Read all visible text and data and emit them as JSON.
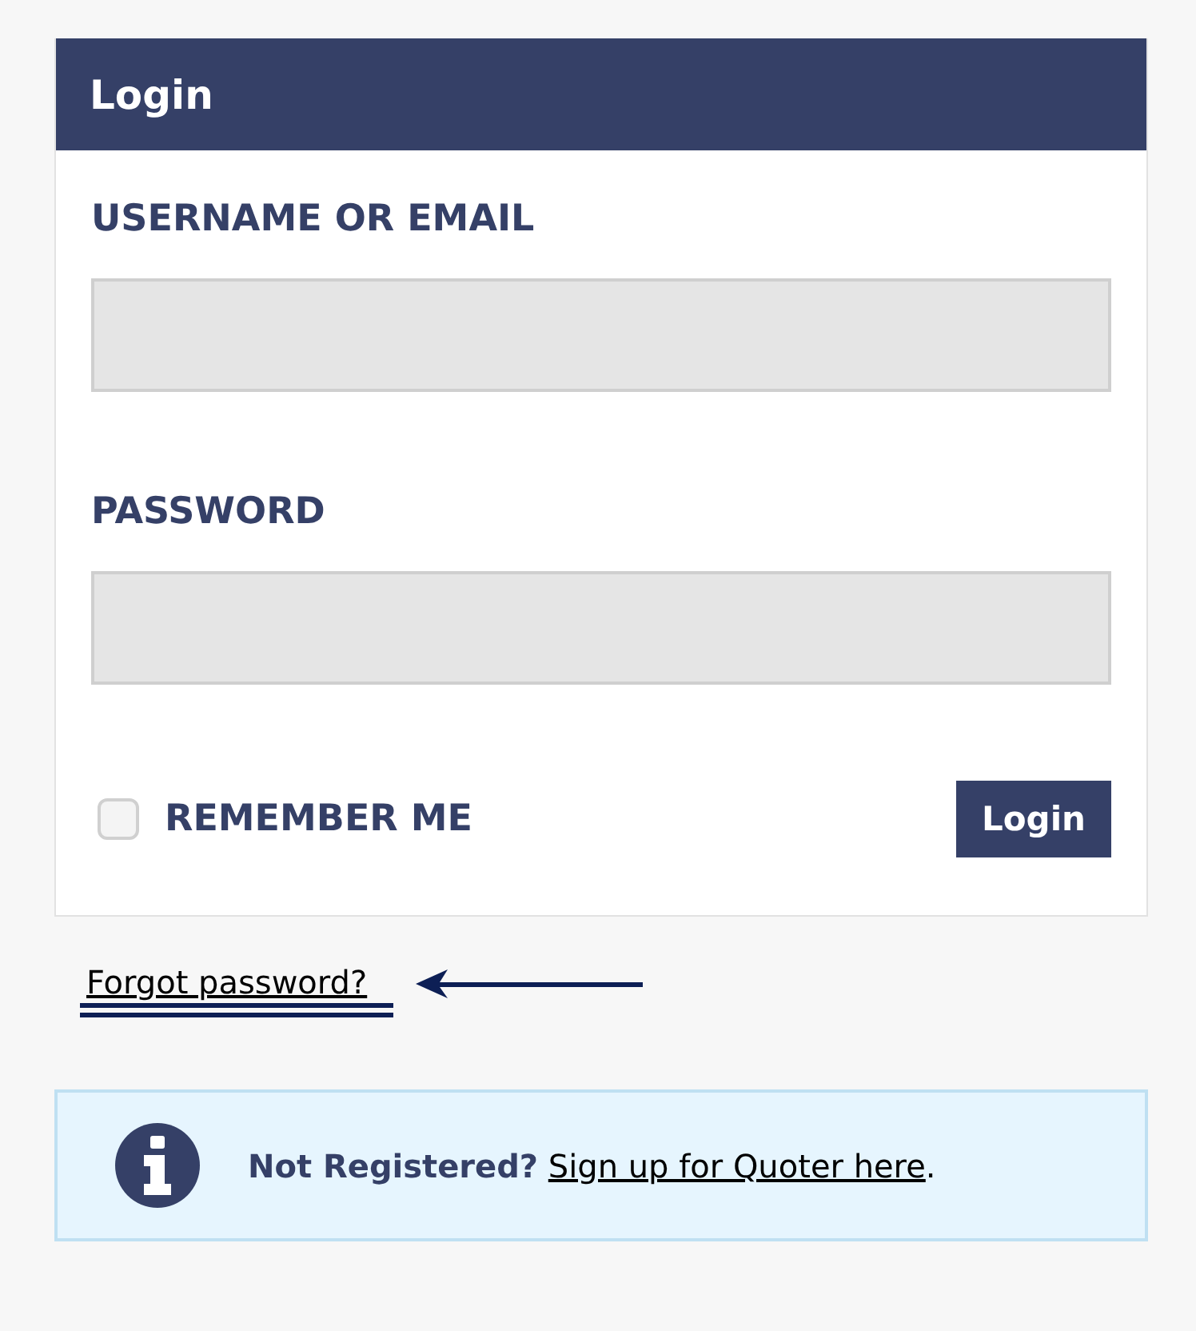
{
  "panel": {
    "title": "Login"
  },
  "fields": [
    {
      "label": "USERNAME OR EMAIL"
    },
    {
      "label": "PASSWORD"
    }
  ],
  "remember": {
    "label": "REMEMBER ME",
    "checked": false
  },
  "submit": "Login",
  "forgot": "Forgot password?",
  "notice": {
    "lead": "Not Registered?",
    "link": "Sign up for Quoter here",
    "trail": "."
  }
}
